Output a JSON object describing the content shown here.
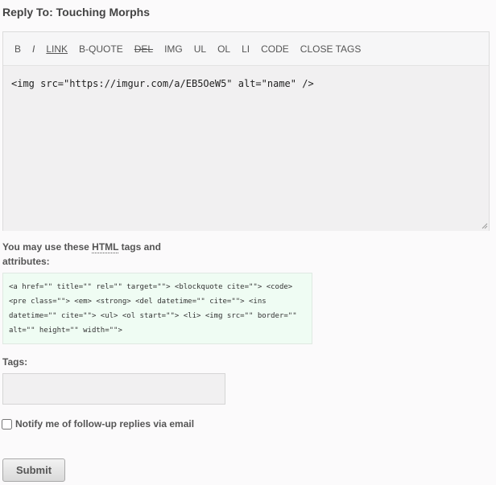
{
  "reply": {
    "title": "Reply To: Touching Morphs"
  },
  "toolbar": {
    "buttons": [
      "B",
      "I",
      "LINK",
      "B-QUOTE",
      "DEL",
      "IMG",
      "UL",
      "OL",
      "LI",
      "CODE",
      "CLOSE TAGS"
    ]
  },
  "editor": {
    "content": "<img src=\"https://imgur.com/a/EB5OeW5\" alt=\"name\" />"
  },
  "allowed": {
    "label_prefix": "You may use these ",
    "label_abbr": "HTML",
    "label_suffix": " tags and attributes:",
    "tags_text": "<a href=\"\" title=\"\" rel=\"\" target=\"\"> <blockquote cite=\"\"> <code> <pre class=\"\"> <em> <strong> <del datetime=\"\" cite=\"\"> <ins datetime=\"\" cite=\"\"> <ul> <ol start=\"\"> <li> <img src=\"\" border=\"\" alt=\"\" height=\"\" width=\"\">"
  },
  "tags": {
    "label": "Tags:",
    "value": ""
  },
  "notify": {
    "label": "Notify me of follow-up replies via email",
    "checked": false
  },
  "submit": {
    "label": "Submit"
  },
  "colors": {
    "allowed_bg": "#effcf3",
    "editor_bg": "#f1f0f1"
  }
}
